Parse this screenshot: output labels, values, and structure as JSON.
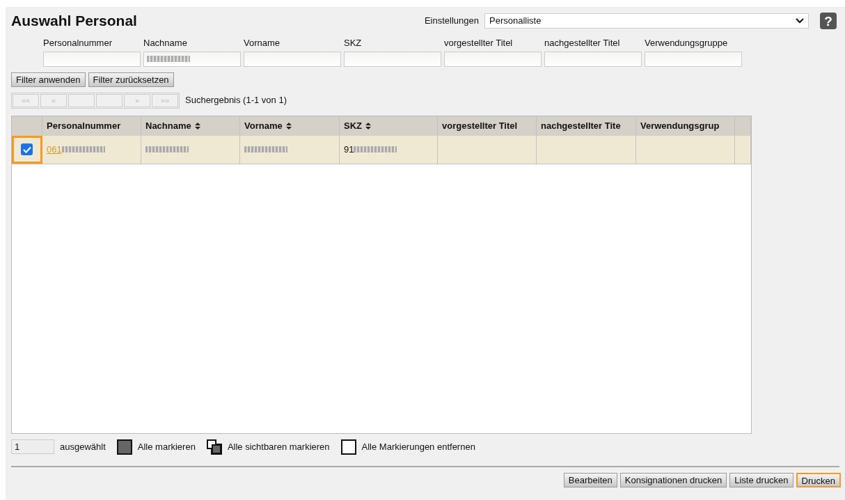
{
  "title": "Auswahl Personal",
  "settings": {
    "label": "Einstellungen",
    "value": "Personalliste",
    "help": "?"
  },
  "filters": [
    {
      "label": "Personalnummer",
      "redacted": false
    },
    {
      "label": "Nachname",
      "redacted": true
    },
    {
      "label": "Vorname",
      "redacted": false
    },
    {
      "label": "SKZ",
      "redacted": false
    },
    {
      "label": "vorgestellter Titel",
      "redacted": false
    },
    {
      "label": "nachgestellter Titel",
      "redacted": false
    },
    {
      "label": "Verwendungsgruppe",
      "redacted": false
    }
  ],
  "filter_buttons": [
    "Filter anwenden",
    "Filter zurücksetzen"
  ],
  "pager": [
    {
      "label": "««",
      "disabled": true
    },
    {
      "label": "«",
      "disabled": true
    },
    {
      "disabled": true
    },
    {
      "disabled": true
    },
    {
      "label": "»",
      "disabled": true
    },
    {
      "label": "»»",
      "disabled": true
    }
  ],
  "result": "Suchergebnis (1-1 von 1)",
  "table": {
    "columns": [
      {
        "label": "Personalnummer",
        "sortable": false
      },
      {
        "label": "Nachname",
        "sortable": true
      },
      {
        "label": "Vorname",
        "sortable": true
      },
      {
        "label": "SKZ",
        "sortable": true
      },
      {
        "label": "vorgestellter Titel",
        "sortable": false
      },
      {
        "label": "nachgestellter Tite",
        "sortable": false
      },
      {
        "label": "Verwendungsgrup",
        "sortable": false
      }
    ],
    "rows": [
      {
        "checked": true,
        "highlighted": true,
        "cells": [
          {
            "text": "061",
            "link": true,
            "redacted": true
          },
          {
            "redacted": true
          },
          {
            "redacted": true
          },
          {
            "text": "91",
            "link": false,
            "redacted": true
          },
          {},
          {},
          {}
        ]
      }
    ]
  },
  "selection": {
    "count": "1",
    "label": "ausgewählt",
    "actions": [
      {
        "kind": "all",
        "label": "Alle markieren"
      },
      {
        "kind": "visible",
        "label": "Alle sichtbaren markieren"
      },
      {
        "kind": "none",
        "label": "Alle Markierungen entfernen"
      }
    ]
  },
  "buttons": [
    {
      "label": "Bearbeiten",
      "highlighted": false
    },
    {
      "label": "Konsignationen drucken",
      "highlighted": false
    },
    {
      "label": "Liste drucken",
      "highlighted": false
    },
    {
      "label": "Drucken",
      "highlighted": true
    }
  ]
}
